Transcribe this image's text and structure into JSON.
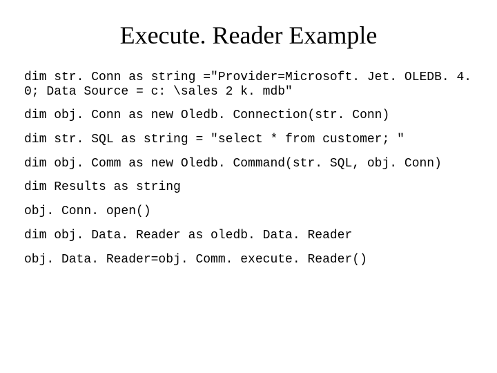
{
  "title": "Execute. Reader Example",
  "code": {
    "line1": "dim str. Conn as string =\"Provider=Microsoft. Jet. OLEDB. 4. 0; Data Source = c: \\sales 2 k. mdb\"",
    "line2": "dim obj. Conn as new Oledb. Connection(str. Conn)",
    "line3": "dim str. SQL as string = \"select * from customer; \"",
    "line4": "dim obj. Comm as new Oledb. Command(str. SQL, obj. Conn)",
    "line5": "dim Results as string",
    "line6": "obj. Conn. open()",
    "line7": "dim obj. Data. Reader as oledb. Data. Reader",
    "line8": "obj. Data. Reader=obj. Comm. execute. Reader()"
  }
}
